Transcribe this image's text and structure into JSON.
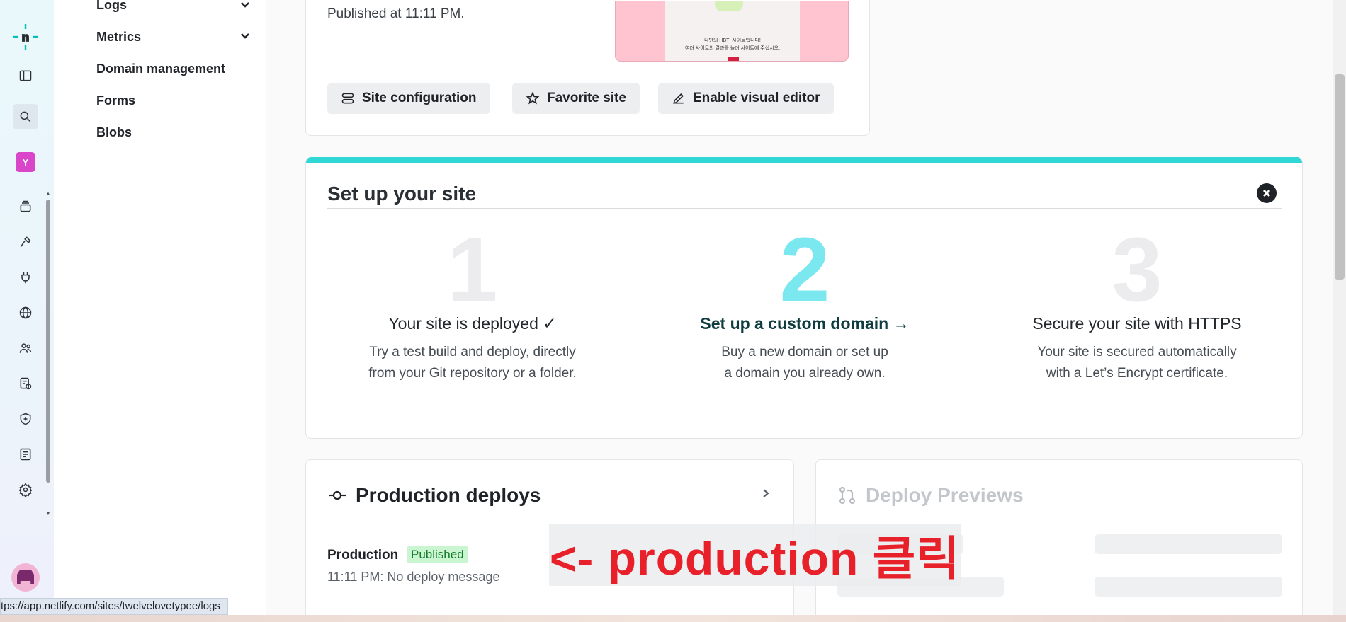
{
  "rail": {
    "icons": [
      "netlify-logo-icon",
      "sidebar-toggle-icon",
      "search-icon",
      "team-avatar",
      "sites-stack-icon",
      "builds-hammer-icon",
      "integrations-plug-icon",
      "domains-globe-icon",
      "members-icon",
      "billing-icon",
      "security-shield-icon",
      "audit-log-icon",
      "settings-gear-icon"
    ],
    "team_initial": "Y"
  },
  "sidenav": {
    "items": [
      {
        "label": "Logs",
        "expandable": true
      },
      {
        "label": "Metrics",
        "expandable": true
      },
      {
        "label": "Domain management",
        "expandable": false
      },
      {
        "label": "Forms",
        "expandable": false
      },
      {
        "label": "Blobs",
        "expandable": false
      }
    ]
  },
  "overview": {
    "published_at": "Published at 11:11 PM.",
    "preview_lines": [
      "나만의 HBTI 사이트입니다!",
      "여러 사이트의 결과를 놀러 사이트에 주십시오."
    ],
    "buttons": {
      "site_configuration": "Site configuration",
      "favorite_site": "Favorite site",
      "enable_visual_editor": "Enable visual editor"
    }
  },
  "setup": {
    "title": "Set up your site",
    "accent_color": "#30d8d5",
    "steps": [
      {
        "num": "1",
        "title": "Your site is deployed ✓",
        "desc_1": "Try a test build and deploy, directly",
        "desc_2": "from your Git repository or a folder.",
        "active": false
      },
      {
        "num": "2",
        "title": "Set up a custom domain →",
        "desc_1": "Buy a new domain or set up",
        "desc_2": "a domain you already own.",
        "active": true
      },
      {
        "num": "3",
        "title": "Secure your site with HTTPS",
        "desc_1": "Your site is secured automatically",
        "desc_2": "with a Let’s Encrypt certificate.",
        "active": false
      }
    ]
  },
  "production": {
    "title": "Production deploys",
    "label": "Production",
    "status": "Published",
    "message": "11:11 PM: No deploy message"
  },
  "previews": {
    "title": "Deploy Previews"
  },
  "annotation": "<- production 클릭",
  "status_url": "tps://app.netlify.com/sites/twelvelovetypee/logs"
}
